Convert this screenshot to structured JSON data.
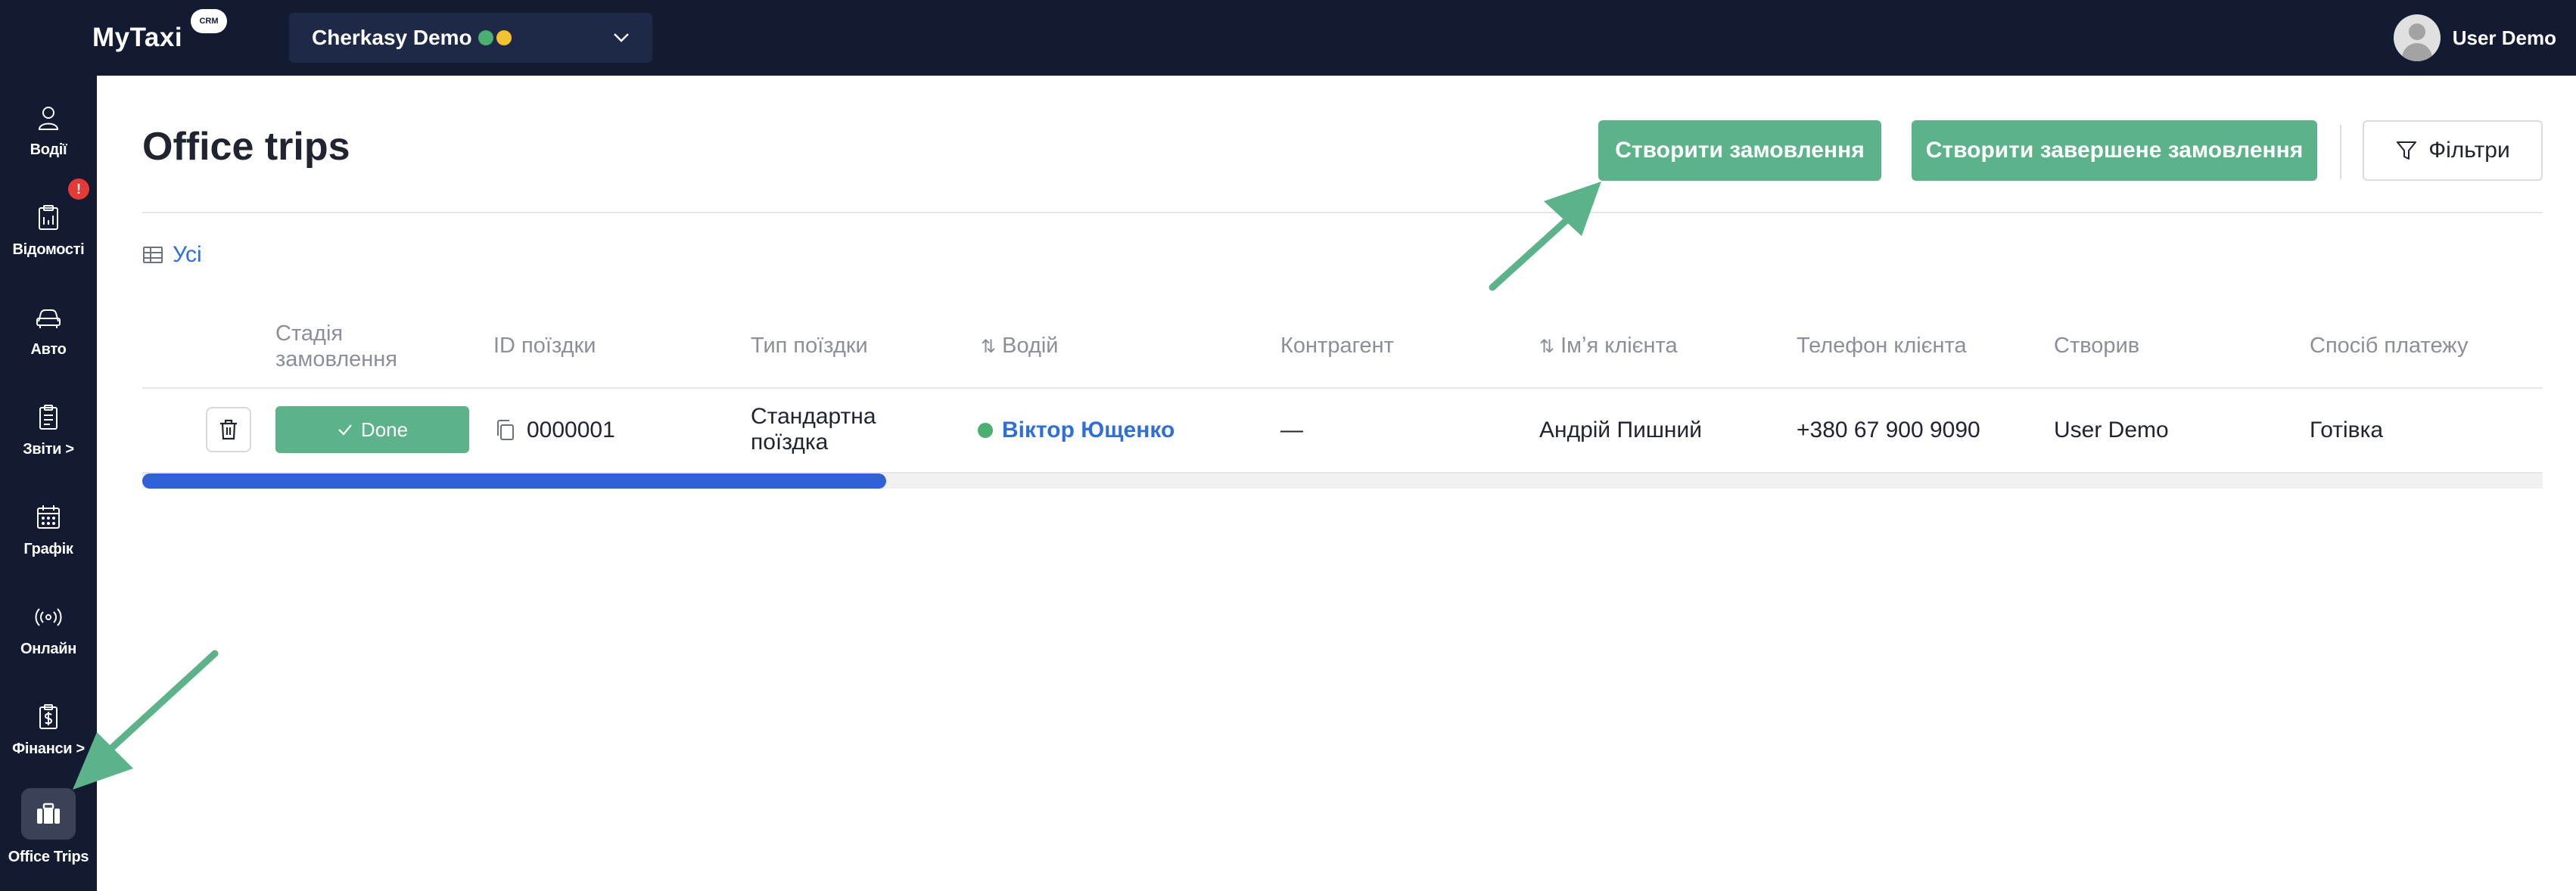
{
  "app": {
    "logo": "MyTaxi",
    "logo_badge": "CRM",
    "company": "Cherkasy Demo",
    "status_colors": [
      "#4caf72",
      "#f2c230"
    ],
    "user": "User Demo"
  },
  "sidebar": {
    "items": [
      {
        "label": "Водії",
        "icon": "driver-icon"
      },
      {
        "label": "Відомості",
        "icon": "clipboard-icon",
        "badge": "!"
      },
      {
        "label": "Авто",
        "icon": "car-icon"
      },
      {
        "label": "Звіти >",
        "icon": "report-icon"
      },
      {
        "label": "Графік",
        "icon": "calendar-icon"
      },
      {
        "label": "Онлайн",
        "icon": "broadcast-icon"
      },
      {
        "label": "Фінанси >",
        "icon": "finance-icon"
      },
      {
        "label": "Office Trips",
        "icon": "briefcase-icon",
        "active": true
      }
    ]
  },
  "page": {
    "title": "Office trips",
    "create_button": "Створити замовлення",
    "create_done_button": "Створити завершене замовлення",
    "filter_button": "Фільтри",
    "view_tab": "Усі"
  },
  "table": {
    "headers": {
      "stage": "Стадія замовлення",
      "trip_id": "ID поїздки",
      "trip_type": "Тип поїздки",
      "driver": "Водій",
      "contractor": "Контрагент",
      "client_name": "Імʼя клієнта",
      "client_phone": "Телефон клієнта",
      "created_by": "Створив",
      "payment": "Спосіб платежу"
    },
    "rows": [
      {
        "stage": "Done",
        "trip_id": "0000001",
        "trip_type": "Стандартна поїздка",
        "driver": "Віктор Ющенко",
        "contractor": "—",
        "client_name": "Андрій Пишний",
        "client_phone": "+380 67 900 9090",
        "created_by": "User Demo",
        "payment": "Готівка"
      }
    ],
    "horizontal_scroll_fraction": 0.31
  },
  "colors": {
    "nav_bg": "#131b33",
    "accent_green": "#5cb38a",
    "link_blue": "#2f6fd6",
    "scroll_blue": "#2f62d6",
    "arrow_green": "#5cb38a"
  }
}
